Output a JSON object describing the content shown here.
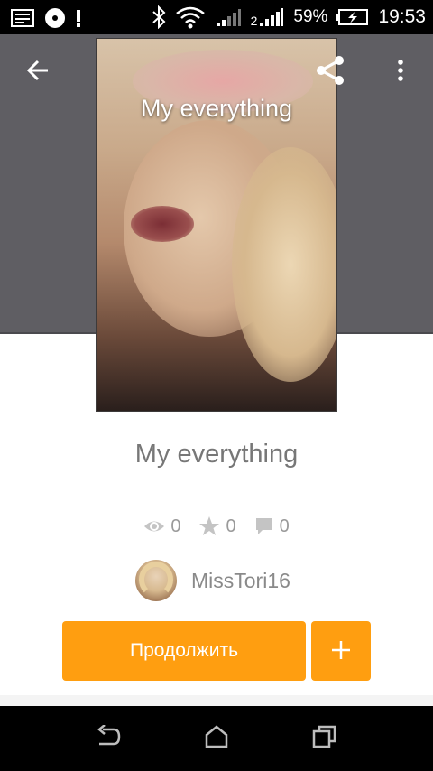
{
  "status_bar": {
    "battery_percent": "59%",
    "time": "19:53",
    "icons": [
      "gallery-icon",
      "media-notification-icon",
      "alert-icon",
      "bluetooth-icon",
      "wifi-icon",
      "signal-1-icon",
      "signal-2-icon",
      "battery-charging-icon"
    ],
    "sim2_label": "2"
  },
  "header": {
    "back_icon": "arrow-left-icon",
    "share_icon": "share-icon",
    "menu_icon": "more-vert-icon",
    "background_color": "#5f5e63"
  },
  "cover": {
    "title": "My everything"
  },
  "story": {
    "title": "My everything",
    "stats": {
      "views": "0",
      "votes": "0",
      "comments": "0"
    }
  },
  "author": {
    "name": "MissTori16"
  },
  "actions": {
    "continue_label": "Продолжить",
    "add_label": "+",
    "accent_color": "#ff9e10"
  },
  "nav_bar": {
    "icons": [
      "nav-back-icon",
      "nav-home-icon",
      "nav-recent-apps-icon"
    ]
  }
}
